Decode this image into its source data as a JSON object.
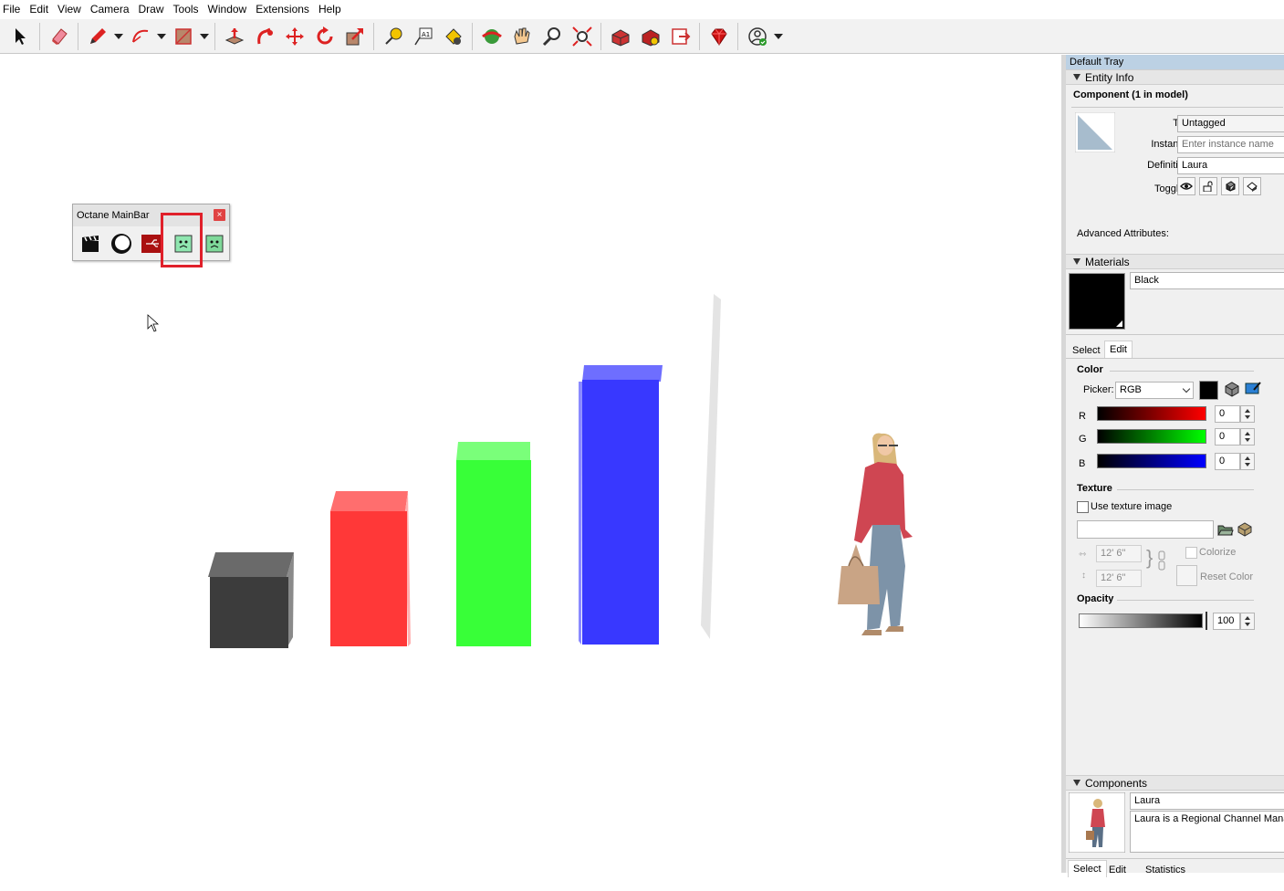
{
  "menu": [
    "File",
    "Edit",
    "View",
    "Camera",
    "Draw",
    "Tools",
    "Window",
    "Extensions",
    "Help"
  ],
  "toolbar_icons": [
    "select-icon",
    "eraser-icon",
    "pencil-icon",
    "arc-icon",
    "rectangle-icon",
    "push-pull-icon",
    "follow-me-icon",
    "move-icon",
    "rotate-icon",
    "scale-icon",
    "tape-measure-icon",
    "text-icon",
    "paint-bucket-icon",
    "orbit-icon",
    "pan-icon",
    "zoom-icon",
    "zoom-extents-icon",
    "warehouse-icon",
    "extension-warehouse-icon",
    "send-to-layout-icon",
    "ruby-console-icon",
    "account-icon"
  ],
  "octane": {
    "title": "Octane MainBar",
    "close": "×",
    "icons": [
      "clapperboard-icon",
      "moon-icon",
      "usb-icon",
      "face-green-icon",
      "face-green-2-icon"
    ]
  },
  "tray": {
    "title": "Default Tray",
    "entity_info": {
      "header": "Entity Info",
      "component_title": "Component (1 in model)",
      "tag_label": "Tag:",
      "tag_value": "Untagged",
      "instance_label": "Instance:",
      "instance_placeholder": "Enter instance name",
      "definition_label": "Definition:",
      "definition_value": "Laura",
      "toggles_label": "Toggles:",
      "advanced_label": "Advanced Attributes:"
    },
    "materials": {
      "header": "Materials",
      "name": "Black",
      "swatch_color": "#000000",
      "tab_select": "Select",
      "tab_edit": "Edit",
      "color_heading": "Color",
      "picker_label": "Picker:",
      "picker_value": "RGB",
      "r_label": "R",
      "r_value": "0",
      "g_label": "G",
      "g_value": "0",
      "b_label": "B",
      "b_value": "0",
      "texture_heading": "Texture",
      "use_texture_label": "Use texture image",
      "width_value": "12' 6\"",
      "height_value": "12' 6\"",
      "colorize_label": "Colorize",
      "reset_color_label": "Reset Color",
      "opacity_heading": "Opacity",
      "opacity_value": "100"
    },
    "components": {
      "header": "Components",
      "name": "Laura",
      "description": "Laura is a Regional Channel Manager",
      "tab_select": "Select",
      "tab_edit": "Edit",
      "tab_statistics": "Statistics"
    }
  },
  "scene_colors": {
    "gray_box": "#3c3c3c",
    "red_box": "#ff3333",
    "green_box": "#33ff33",
    "blue_box": "#3333ff"
  }
}
